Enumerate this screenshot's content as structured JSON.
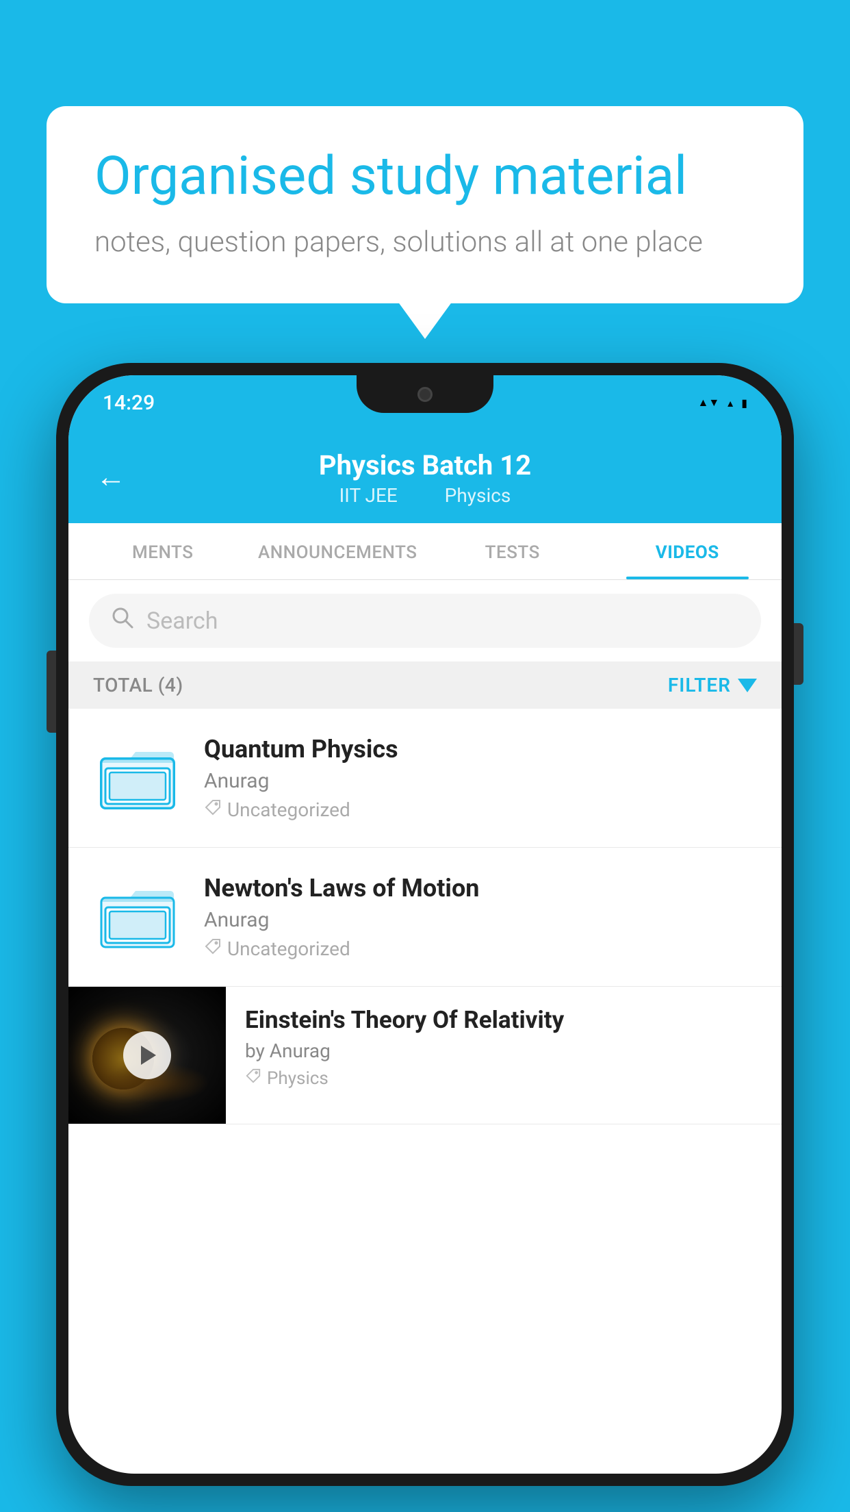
{
  "background_color": "#1ab9e8",
  "speech_bubble": {
    "heading": "Organised study material",
    "subtext": "notes, question papers, solutions all at one place"
  },
  "phone": {
    "status_bar": {
      "time": "14:29",
      "icons": [
        "wifi",
        "signal",
        "battery"
      ]
    },
    "header": {
      "back_label": "←",
      "title": "Physics Batch 12",
      "subtitle_part1": "IIT JEE",
      "subtitle_part2": "Physics"
    },
    "tabs": [
      {
        "label": "MENTS",
        "active": false
      },
      {
        "label": "ANNOUNCEMENTS",
        "active": false
      },
      {
        "label": "TESTS",
        "active": false
      },
      {
        "label": "VIDEOS",
        "active": true
      }
    ],
    "search": {
      "placeholder": "Search"
    },
    "filter_bar": {
      "total_label": "TOTAL (4)",
      "filter_label": "FILTER"
    },
    "videos": [
      {
        "id": 1,
        "title": "Quantum Physics",
        "author": "Anurag",
        "tag": "Uncategorized",
        "type": "folder"
      },
      {
        "id": 2,
        "title": "Newton's Laws of Motion",
        "author": "Anurag",
        "tag": "Uncategorized",
        "type": "folder"
      },
      {
        "id": 3,
        "title": "Einstein's Theory Of Relativity",
        "author": "by Anurag",
        "tag": "Physics",
        "type": "video"
      }
    ]
  }
}
